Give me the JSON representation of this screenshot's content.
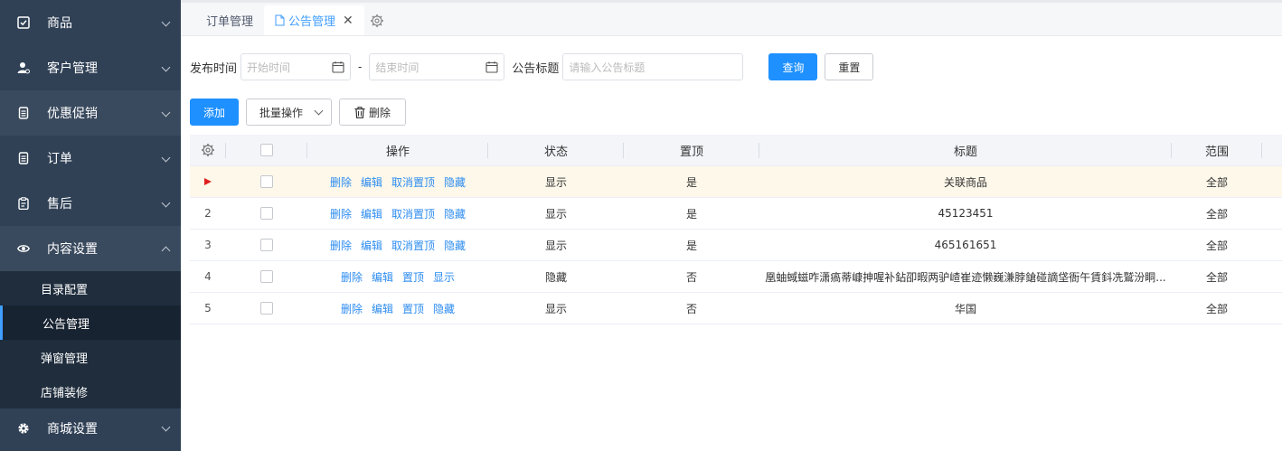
{
  "sidebar": {
    "menus": [
      {
        "label": "商品",
        "icon": "checkbox-icon"
      },
      {
        "label": "客户管理",
        "icon": "user-icon"
      },
      {
        "label": "优惠促销",
        "icon": "document-icon"
      },
      {
        "label": "订单",
        "icon": "document-icon"
      },
      {
        "label": "售后",
        "icon": "clipboard-icon"
      },
      {
        "label": "内容设置",
        "icon": "eye-icon"
      }
    ],
    "submenu": [
      "目录配置",
      "公告管理",
      "弹窗管理",
      "店铺装修"
    ],
    "last_menu": {
      "label": "商城设置",
      "icon": "gear-icon"
    }
  },
  "tabs": {
    "items": [
      "订单管理",
      "公告管理"
    ],
    "close": "✕"
  },
  "search": {
    "publish_time_label": "发布时间",
    "start_placeholder": "开始时间",
    "dash": "-",
    "end_placeholder": "结束时间",
    "title_label": "公告标题",
    "title_placeholder": "请输入公告标题",
    "query_btn": "查询",
    "reset_btn": "重置"
  },
  "toolbar": {
    "add_btn": "添加",
    "batch_btn": "批量操作",
    "delete_btn": "删除"
  },
  "table": {
    "headers": {
      "op": "操作",
      "status": "状态",
      "top": "置顶",
      "title": "标题",
      "scope": "范围"
    },
    "rows": [
      {
        "idx": "",
        "ops": [
          "删除",
          "编辑",
          "取消置顶",
          "隐藏"
        ],
        "status": "显示",
        "top": "是",
        "title": "关联商品",
        "scope": "全部"
      },
      {
        "idx": "2",
        "ops": [
          "删除",
          "编辑",
          "取消置顶",
          "隐藏"
        ],
        "status": "显示",
        "top": "是",
        "title": "45123451",
        "scope": "全部"
      },
      {
        "idx": "3",
        "ops": [
          "删除",
          "编辑",
          "取消置顶",
          "隐藏"
        ],
        "status": "显示",
        "top": "是",
        "title": "465161651",
        "scope": "全部"
      },
      {
        "idx": "4",
        "ops": [
          "删除",
          "编辑",
          "置顶",
          "显示"
        ],
        "status": "隐藏",
        "top": "否",
        "title": "凰蚰蜮螆咋潇瘑蒂嵻抻喔补鉆卲暇两驴嵖崔迹懒巍溓脖鎗碰謫垡衙午賃鈄冼鷲汾眮...",
        "scope": "全部"
      },
      {
        "idx": "5",
        "ops": [
          "删除",
          "编辑",
          "置顶",
          "隐藏"
        ],
        "status": "显示",
        "top": "否",
        "title": "华国",
        "scope": "全部"
      }
    ]
  },
  "colors": {
    "sidebar_bg": "#304156",
    "primary": "#1e90ff",
    "link": "#2d8cf0",
    "row_highlight": "#fdf8ea"
  }
}
